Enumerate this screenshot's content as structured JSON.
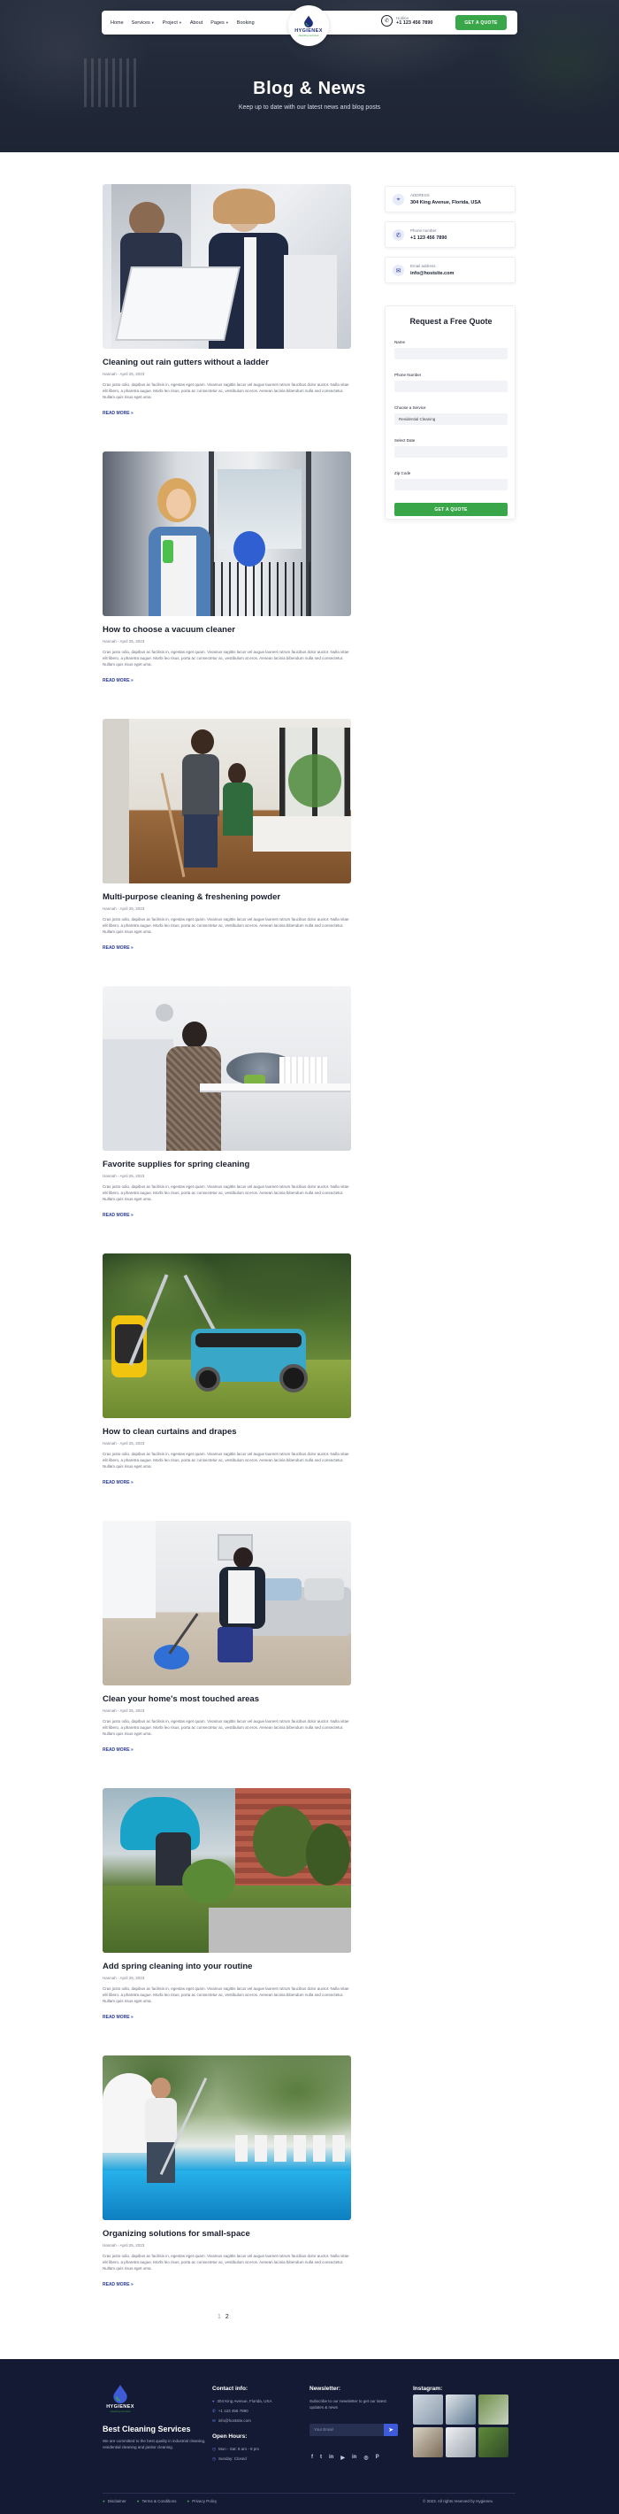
{
  "nav": {
    "links": [
      "Home",
      "Services",
      "Project",
      "About",
      "Pages",
      "Booking"
    ],
    "has_dropdown": [
      false,
      true,
      true,
      false,
      true,
      false
    ],
    "logo_name": "HYGIENEX",
    "logo_tag": "cleaning services",
    "phone_label": "Hotline",
    "phone_number": "+1 123 456 7890",
    "cta_label": "GET A QUOTE"
  },
  "hero": {
    "title": "Blog & News",
    "subtitle": "Keep up to date with our latest news and blog posts"
  },
  "posts": [
    {
      "title": "Cleaning out rain gutters without a ladder",
      "meta": "Hannah - April 25, 2023",
      "read_more": "READ MORE »"
    },
    {
      "title": "How to choose a vacuum cleaner",
      "meta": "Hannah - April 25, 2023",
      "read_more": "READ MORE »"
    },
    {
      "title": "Multi-purpose cleaning & freshening powder",
      "meta": "Hannah - April 25, 2023",
      "read_more": "READ MORE »"
    },
    {
      "title": "Favorite supplies for spring cleaning",
      "meta": "Hannah - April 25, 2023",
      "read_more": "READ MORE »"
    },
    {
      "title": "How to clean curtains and drapes",
      "meta": "Hannah - April 25, 2023",
      "read_more": "READ MORE »"
    },
    {
      "title": "Clean your home's most touched areas",
      "meta": "Hannah - April 25, 2023",
      "read_more": "READ MORE »"
    },
    {
      "title": "Add spring cleaning into your routine",
      "meta": "Hannah - April 25, 2023",
      "read_more": "READ MORE »"
    },
    {
      "title": "Organizing solutions for small-space",
      "meta": "Hannah - April 25, 2023",
      "read_more": "READ MORE »"
    }
  ],
  "excerpt": "Cras justo odio, dapibus ac facilisis in, egestas eget quam. Vivamus sagittis lacus vel augue laoreet rutrum faucibus dolor auctor. Nulla vitae elit libero, a pharetra augue. Morbi leo risus, porta ac consectetur ac, vestibulum at eros. Aenean lacinia bibendum nulla sed consectetur. Nullam quis risus eget urna.",
  "sidebar": {
    "info": [
      {
        "label": "ADDRESS",
        "value": "304 King Avenue, Florida, USA",
        "icon": "map-pin-icon"
      },
      {
        "label": "Phone number",
        "value": "+1 123 456 7890",
        "icon": "phone-icon"
      },
      {
        "label": "Email address",
        "value": "info@hostsite.com",
        "icon": "mail-icon"
      }
    ],
    "quote": {
      "title": "Request a Free Quote",
      "fields": [
        {
          "label": "Name",
          "value": ""
        },
        {
          "label": "Phone Number",
          "value": ""
        },
        {
          "label": "Choose a Service",
          "value": "Residential Cleaning"
        },
        {
          "label": "Select Date",
          "value": ""
        },
        {
          "label": "Zip Code",
          "value": ""
        }
      ],
      "submit": "GET A QUOTE"
    }
  },
  "pagination": [
    "1",
    "2"
  ],
  "footer": {
    "logo_name": "HYGIENEX",
    "logo_tag": "cleaning services",
    "heading": "Best Cleaning Services",
    "text": "We are committed to the best quality in industrial cleaning, residential cleaning and janitor cleaning.",
    "contact_title": "Contact info:",
    "contact": [
      "304 King Avenue, Florida, USA",
      "+1 123 456 7890",
      "info@hostsite.com"
    ],
    "hours_title": "Open Hours:",
    "hours": [
      "Mon - Sat: 8 am - 9 pm",
      "Sunday: Closed"
    ],
    "newsletter_title": "Newsletter:",
    "newsletter_text": "Subscribe to our newsletter to get our latest updates & news",
    "newsletter_placeholder": "Your Email",
    "socials": [
      "f",
      "t",
      "in",
      "▶",
      "in",
      "◎",
      "P"
    ],
    "instagram_title": "Instagram:",
    "bottom_links": [
      "Disclaimer",
      "Terms & Conditions",
      "Privacy Policy"
    ],
    "copyright": "© 2023. All rights reserved by Hygienex."
  },
  "colors": {
    "accent_green": "#3aa64a",
    "brand_navy": "#1d2e7a",
    "footer_bg": "#141a33"
  }
}
